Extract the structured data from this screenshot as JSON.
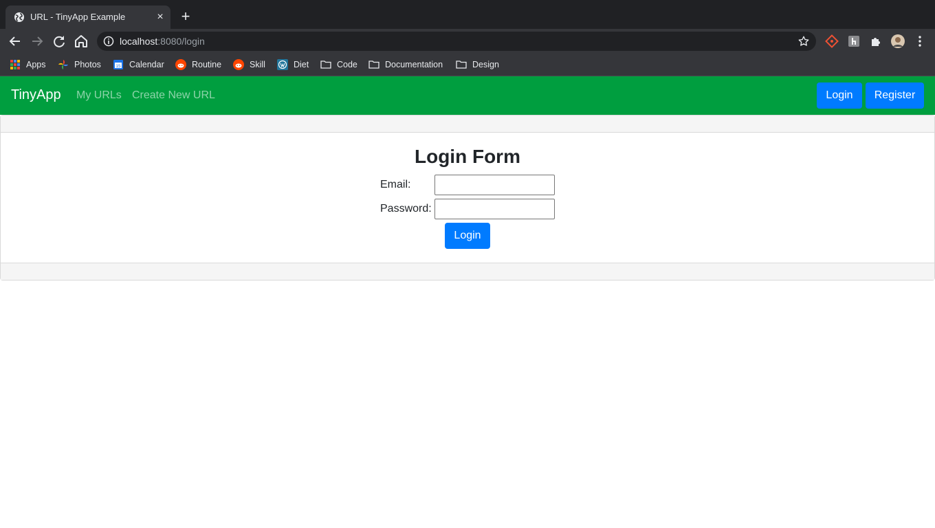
{
  "browser": {
    "tab": {
      "title": "URL - TinyApp Example",
      "favicon": "globe-icon",
      "close_icon": "×"
    },
    "new_tab_icon": "+",
    "address": {
      "host": "localhost",
      "rest": ":8080/login"
    },
    "bookmarks": [
      {
        "label": "Apps",
        "icon": "apps-grid-icon"
      },
      {
        "label": "Photos",
        "icon": "photos-pinwheel-icon"
      },
      {
        "label": "Calendar",
        "icon": "calendar-icon",
        "icon_text": "15"
      },
      {
        "label": "Routine",
        "icon": "reddit-icon"
      },
      {
        "label": "Skill",
        "icon": "reddit-icon"
      },
      {
        "label": "Diet",
        "icon": "wordpress-icon"
      },
      {
        "label": "Code",
        "icon": "folder-icon"
      },
      {
        "label": "Documentation",
        "icon": "folder-icon"
      },
      {
        "label": "Design",
        "icon": "folder-icon"
      }
    ]
  },
  "navbar": {
    "brand": "TinyApp",
    "links": [
      "My URLs",
      "Create New URL"
    ],
    "login_label": "Login",
    "register_label": "Register"
  },
  "form": {
    "title": "Login Form",
    "email_label": "Email:",
    "email_value": "",
    "password_label": "Password:",
    "password_value": "",
    "submit_label": "Login"
  },
  "colors": {
    "navbar": "#009e3f",
    "primary": "#007bff",
    "chrome_dark": "#202124",
    "chrome_toolbar": "#35363a"
  }
}
